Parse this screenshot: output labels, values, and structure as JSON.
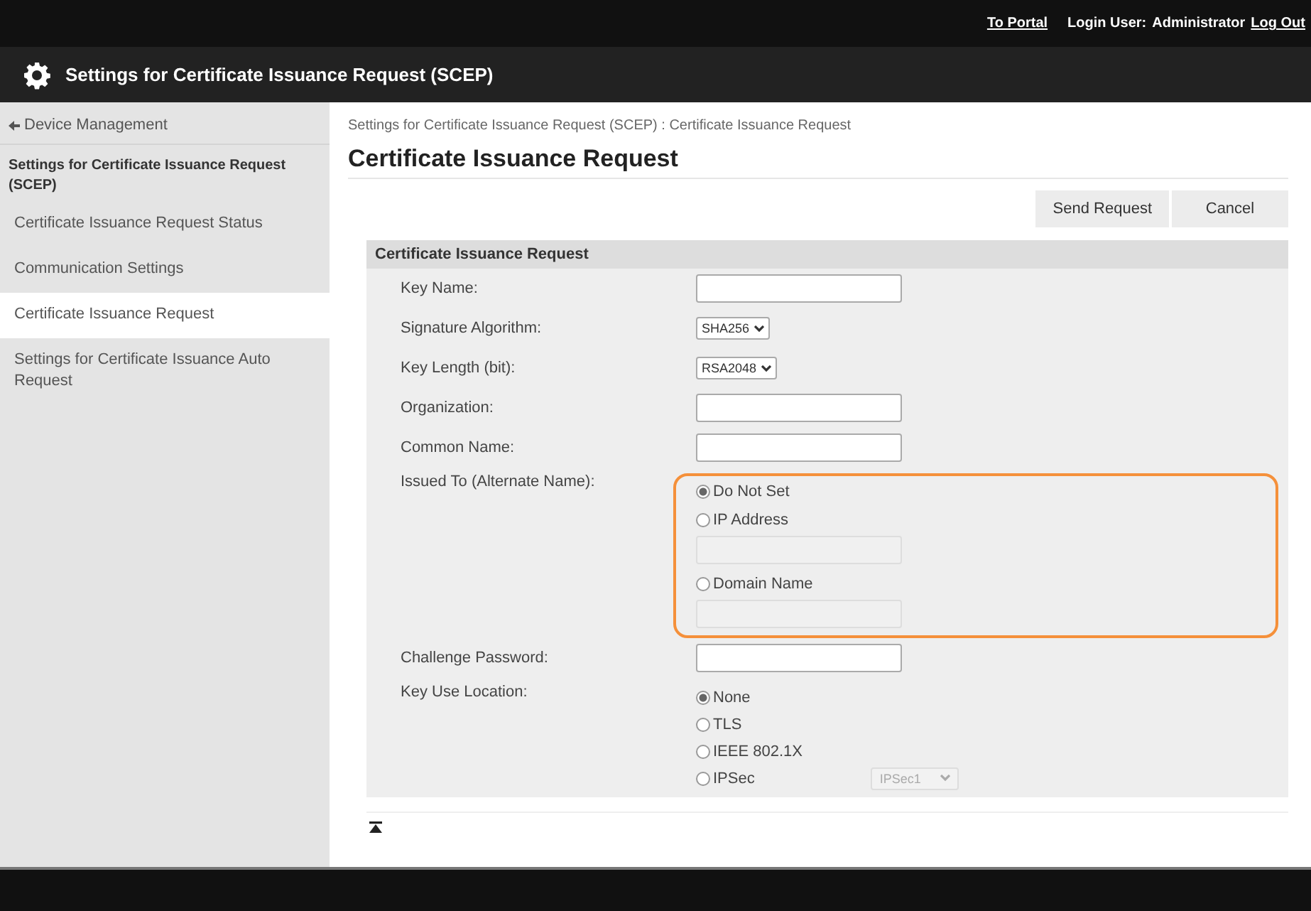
{
  "header": {
    "portal_link": "To Portal",
    "user_label": "Login User:",
    "user_name": "Administrator",
    "logout": "Log Out"
  },
  "title": "Settings for Certificate Issuance Request (SCEP)",
  "sidebar": {
    "back": "Device Management",
    "section": "Settings for Certificate Issuance Request (SCEP)",
    "items": [
      {
        "label": "Certificate Issuance Request Status",
        "selected": false
      },
      {
        "label": "Communication Settings",
        "selected": false
      },
      {
        "label": "Certificate Issuance Request",
        "selected": true
      },
      {
        "label": "Settings for Certificate Issuance Auto Request",
        "selected": false
      }
    ]
  },
  "breadcrumb": "Settings for Certificate Issuance Request (SCEP) : Certificate Issuance Request",
  "heading": "Certificate Issuance Request",
  "buttons": [
    "Send Request",
    "Cancel"
  ],
  "form": {
    "title": "Certificate Issuance Request",
    "rows": [
      {
        "kind": "text",
        "label": "Key Name:"
      },
      {
        "kind": "select",
        "label": "Signature Algorithm:",
        "value": "SHA256"
      },
      {
        "kind": "select",
        "label": "Key Length (bit):",
        "value": "RSA2048"
      },
      {
        "kind": "text",
        "label": "Organization:"
      },
      {
        "kind": "text",
        "label": "Common Name:"
      },
      {
        "kind": "radio_group",
        "label": "Issued To (Alternate Name):",
        "highlighted": true,
        "options": [
          {
            "label": "Do Not Set",
            "selected": true
          },
          {
            "label": "IP Address",
            "selected": false,
            "field": {
              "kind": "text",
              "disabled": true
            }
          },
          {
            "label": "Domain Name",
            "selected": false,
            "field": {
              "kind": "text",
              "disabled": true
            }
          }
        ]
      },
      {
        "kind": "text",
        "label": "Challenge Password:"
      },
      {
        "kind": "radio_group",
        "label": "Key Use Location:",
        "highlighted": false,
        "options": [
          {
            "label": "None",
            "selected": true
          },
          {
            "label": "TLS",
            "selected": false
          },
          {
            "label": "IEEE 802.1X",
            "selected": false
          },
          {
            "label": "IPSec",
            "selected": false,
            "field": {
              "kind": "select",
              "value": "IPSec1",
              "disabled": true
            }
          }
        ]
      }
    ]
  }
}
